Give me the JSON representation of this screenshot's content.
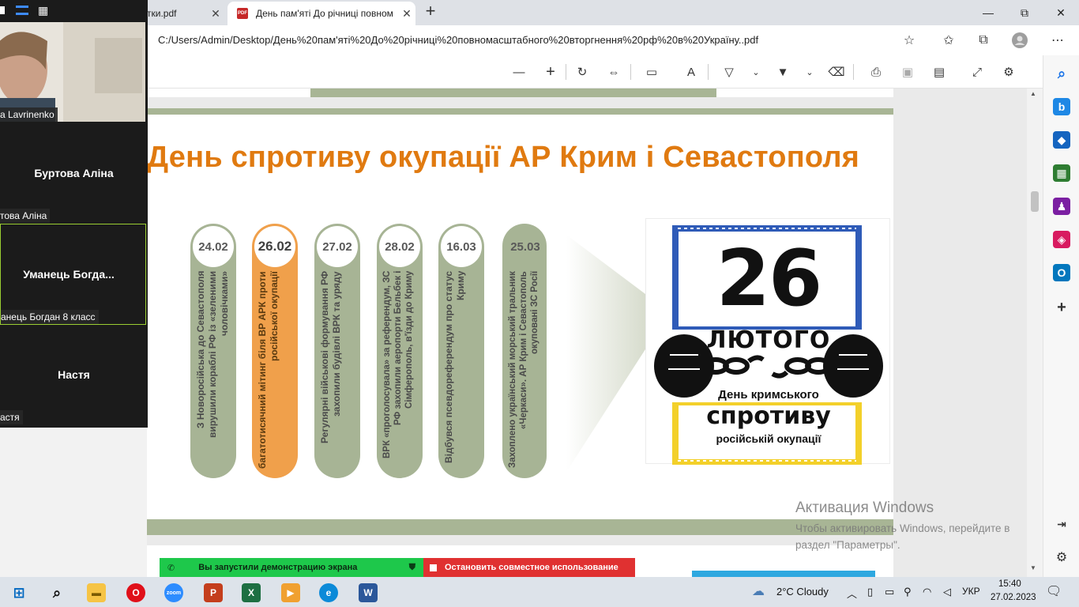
{
  "browser": {
    "tabs": [
      {
        "label": "тки.pdf",
        "active": false
      },
      {
        "label": "День пам'яті До річниці повном",
        "active": true
      }
    ],
    "new_tab": "+",
    "url": "C:/Users/Admin/Desktop/День%20пам'яті%20До%20річниці%20повномасштабного%20вторгнення%20рф%20в%20Україну..pdf"
  },
  "slide": {
    "title": "День спротиву окупації АР Крим і Севастополя",
    "events": [
      {
        "date": "24.02",
        "text": "З Новоросійська до Севастополя вирушили кораблі РФ із «зеленими чоловічками»",
        "highlight": false
      },
      {
        "date": "26.02",
        "text": "багатотисячний мітинг біля ВР АРК проти російської окупації",
        "highlight": true
      },
      {
        "date": "27.02",
        "text": "Регулярні військові формування РФ захопили будівлі ВРК та уряду",
        "highlight": false
      },
      {
        "date": "28.02",
        "text": "ВРК «проголосувала» за референдум, ЗС РФ захопили аеропорти Бельбек і Сімферополь, в'їзди до Криму",
        "highlight": false
      },
      {
        "date": "16.03",
        "text": "Відбувся псевдореферендум про статус Криму",
        "highlight": false
      },
      {
        "date": "25.03",
        "text": "Захоплено український морський тральник «Черкаси». АР Крим і Севастополь окуповані ЗС Росії",
        "highlight": false
      }
    ],
    "poster": {
      "number": "26",
      "month": "ЛЮТОГО",
      "line1": "День кримського",
      "line2": "спротиву",
      "line3": "російській окупації"
    }
  },
  "zoom": {
    "video_name": "a Lavrinenko",
    "participants": [
      {
        "big": "Буртова Аліна",
        "small": "това Аліна"
      },
      {
        "big": "Уманець  Богда...",
        "small": "анець Богдан 8 класс"
      },
      {
        "big": "Настя",
        "small": "астя"
      }
    ]
  },
  "share": {
    "status": "Вы запустили демонстрацию экрана",
    "stop": "Остановить совместное использование"
  },
  "activation": {
    "title": "Активация Windows",
    "desc": "Чтобы активировать Windows, перейдите в раздел \"Параметры\"."
  },
  "taskbar": {
    "weather": "2°C  Cloudy",
    "lang": "УКР",
    "time": "15:40",
    "date": "27.02.2023"
  },
  "colors": {
    "title_orange": "#e07a10",
    "pill_green": "#a7b495",
    "pill_orange": "#f0a04b",
    "share_green": "#1ec84b",
    "share_red": "#e03131"
  }
}
